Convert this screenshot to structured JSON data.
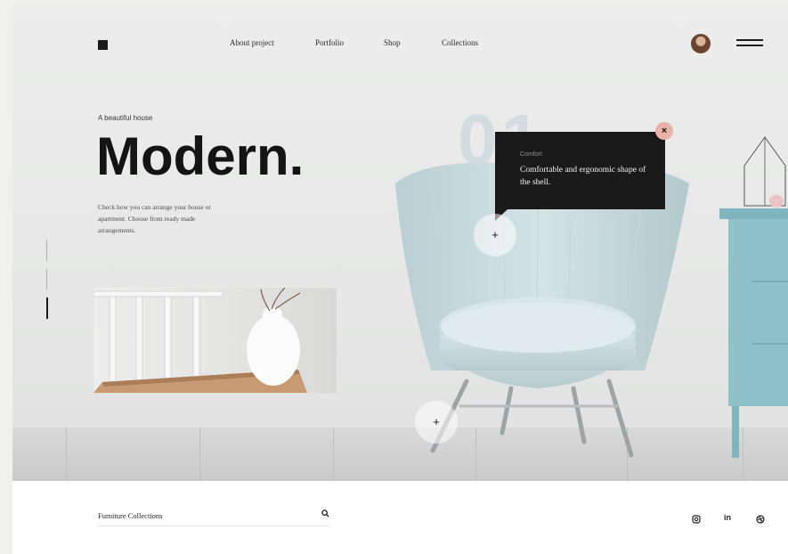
{
  "nav": {
    "items": [
      "About project",
      "Portfolio",
      "Shop",
      "Collections"
    ]
  },
  "hero": {
    "eyebrow": "A beautiful house",
    "title": "Modern.",
    "description": "Check how you can arrange your house or apartment. Choose from ready made arrangements."
  },
  "showcase": {
    "number": "01",
    "tooltip_label": "Comfort",
    "tooltip_text": "Comfortable and ergonomic shape of the shell.",
    "close_symbol": "×",
    "hotspot_symbol": "+"
  },
  "footer": {
    "search_placeholder": "Furniture Collections",
    "social": [
      "instagram-icon",
      "in",
      "dribbble-icon"
    ]
  },
  "colors": {
    "dark": "#1a1a1a",
    "chair": "#c9dde0",
    "cabinet": "#8fc1c8",
    "accent": "#e7b2a8"
  }
}
